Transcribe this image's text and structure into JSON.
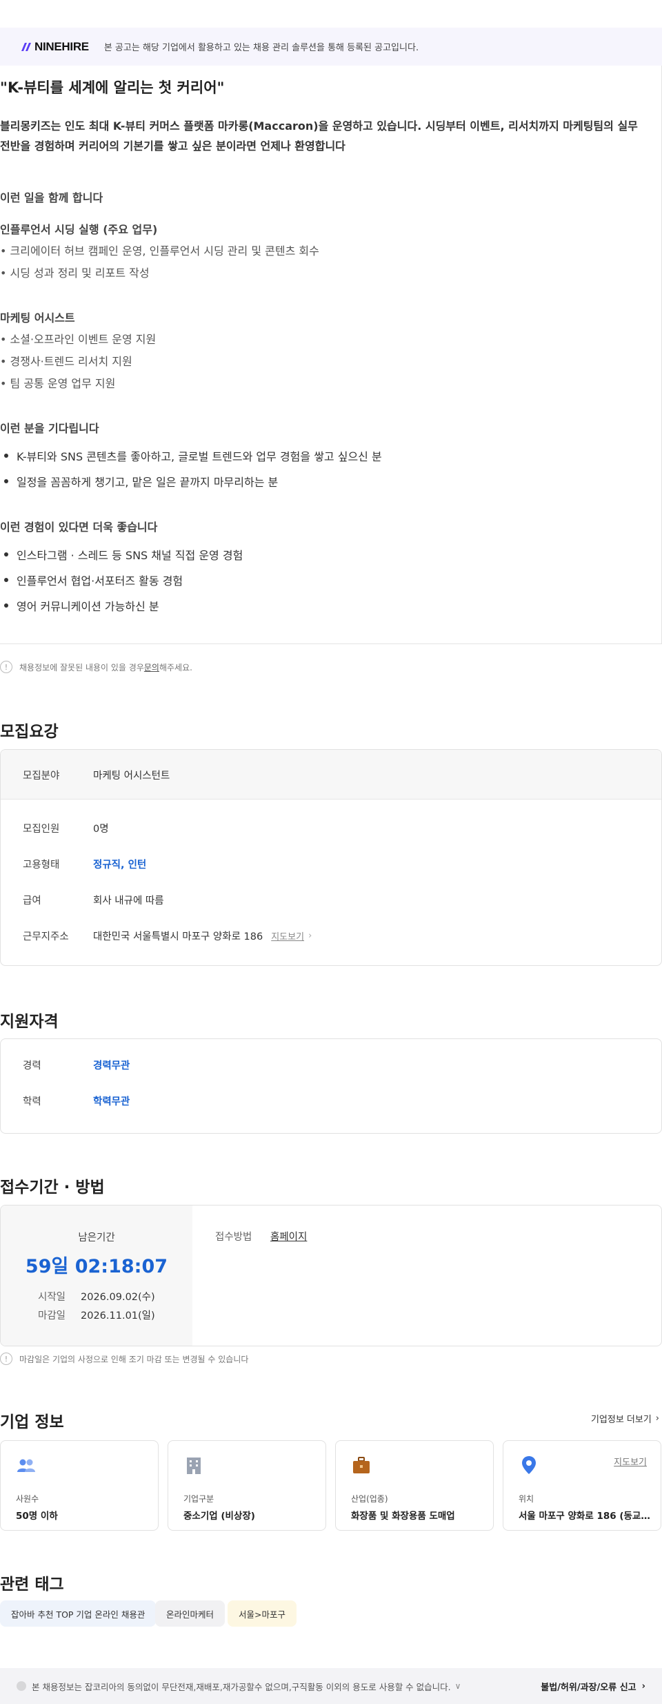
{
  "banner": {
    "logo": "NINEHIRE",
    "note": "본 공고는 해당 기업에서 활용하고 있는 채용 관리 솔루션을 통해 등록된 공고입니다."
  },
  "detail": {
    "headline": "\"K-뷰티를 세계에 알리는 첫 커리어\"",
    "intro": "블리몽키즈는 인도 최대 K-뷰티 커머스 플랫폼 마카롱(Maccaron)을 운영하고 있습니다. 시딩부터 이벤트, 리서치까지 마케팅팀의 실무 전반을 경험하며 커리어의 기본기를 쌓고 싶은 분이라면 언제나 환영합니다",
    "work_title": "이런 일을 함께 합니다",
    "seeding_title": "인플루언서 시딩 실행 (주요 업무)",
    "seeding_items": [
      "• 크리에이터 허브 캠페인 운영, 인플루언서 시딩 관리 및 콘텐츠 회수",
      "• 시딩 성과 정리 및 리포트 작성"
    ],
    "assist_title": "마케팅 어시스트",
    "assist_items": [
      "• 소셜·오프라인 이벤트 운영 지원",
      "• 경쟁사·트렌드 리서치 지원",
      "• 팀 공통 운영 업무 지원"
    ],
    "wait_title": "이런 분을 기다립니다",
    "wait_items": [
      "K-뷰티와 SNS 콘텐츠를 좋아하고, 글로벌 트렌드와 업무 경험을 쌓고 싶으신 분",
      "일정을 꼼꼼하게 챙기고, 맡은 일은 끝까지 마무리하는 분"
    ],
    "plus_title": "이런 경험이 있다면 더욱 좋습니다",
    "plus_items": [
      "인스타그램 · 스레드 등 SNS 채널 직접 운영 경험",
      "인플루언서 협업·서포터즈 활동 경험",
      "영어 커뮤니케이션 가능하신 분"
    ]
  },
  "error_notice": {
    "before": "채용정보에 잘못된 내용이 있을 경우 ",
    "link": "문의",
    "after": "해주세요."
  },
  "recruit": {
    "title": "모집요강",
    "field_label": "모집분야",
    "field_value": "마케팅 어시스턴트",
    "headcount_label": "모집인원",
    "headcount_value": "0명",
    "type_label": "고용형태",
    "type_value": "정규직, 인턴",
    "salary_label": "급여",
    "salary_value": "회사 내규에 따름",
    "address_label": "근무지주소",
    "address_value": "대한민국 서울특별시 마포구 양화로 186",
    "map_link": "지도보기"
  },
  "qualify": {
    "title": "지원자격",
    "career_label": "경력",
    "career_value": "경력무관",
    "edu_label": "학력",
    "edu_value": "학력무관"
  },
  "apply": {
    "title": "접수기간 · 방법",
    "remain_label": "남은기간",
    "remain_value": "59일 02:18:07",
    "start_label": "시작일",
    "start_value": "2026.09.02(수)",
    "end_label": "마감일",
    "end_value": "2026.11.01(일)",
    "method_label": "접수방법",
    "method_value": "홈페이지",
    "notice": "마감일은 기업의 사정으로 인해 조기 마감 또는 변경될 수 있습니다"
  },
  "company": {
    "title": "기업 정보",
    "more": "기업정보 더보기",
    "cards": [
      {
        "label": "사원수",
        "value": "50명 이하"
      },
      {
        "label": "기업구분",
        "value": "중소기업 (비상장)"
      },
      {
        "label": "산업(업종)",
        "value": "화장품 및 화장용품 도매업"
      },
      {
        "label": "위치",
        "value": "서울 마포구 양화로 186 (동교동...",
        "map": "지도보기"
      }
    ]
  },
  "tags": {
    "title": "관련 태그",
    "items": [
      "잡아바 추천 TOP 기업 온라인 채용관",
      "온라인마케터",
      "서울>마포구"
    ]
  },
  "footer": {
    "notice": "본 채용정보는 잡코리아의 동의없이 무단전재,재배포,재가공할수 없으며,구직활동 이외의 용도로 사용할 수 없습니다.",
    "report": "불법/허위/과장/오류 신고"
  },
  "colors": {
    "accent_blue": "#1a63d2",
    "banner_bg": "#f6f5fd",
    "logo_mark": "#5b3df5"
  }
}
